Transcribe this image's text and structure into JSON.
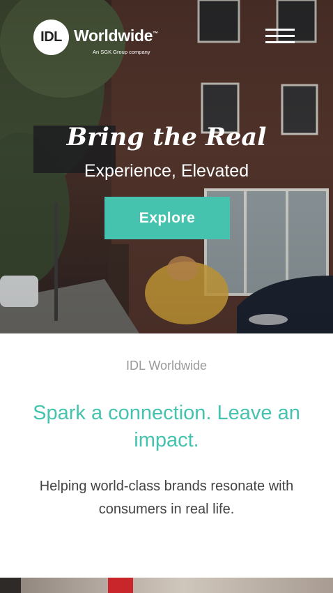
{
  "header": {
    "logo_mark": "IDL",
    "logo_word": "Worldwide",
    "logo_tm": "™",
    "logo_sub": "An SGK Group company"
  },
  "hero": {
    "title": "Bring the Real",
    "subtitle": "Experience, Elevated",
    "cta_label": "Explore"
  },
  "intro": {
    "eyebrow": "IDL Worldwide",
    "headline": "Spark a connection. Leave an impact.",
    "body": "Helping world-class brands resonate with consumers in real life."
  },
  "colors": {
    "accent": "#45c3ae",
    "eyebrow_gray": "#9a9a9a",
    "body_text": "#444444"
  }
}
